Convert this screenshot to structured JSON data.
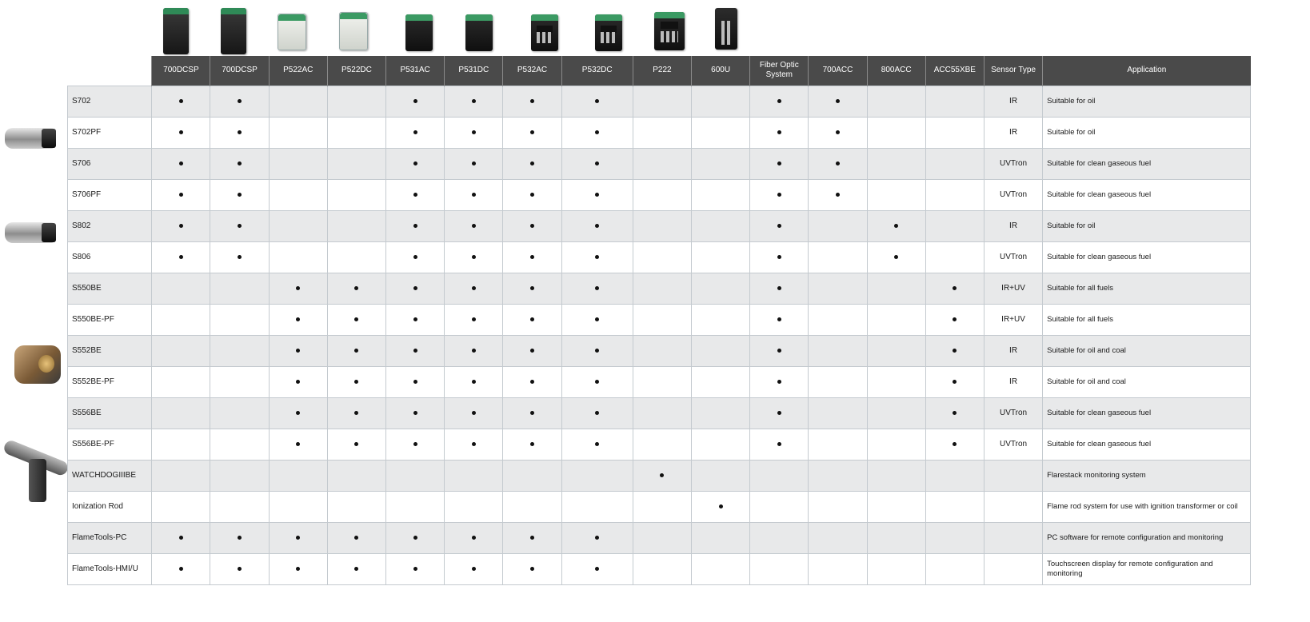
{
  "columns": [
    "700DCSP",
    "700DCSP",
    "P522AC",
    "P522DC",
    "P531AC",
    "P531DC",
    "P532AC",
    "P532DC",
    "P222",
    "600U",
    "Fiber Optic System",
    "700ACC",
    "800ACC",
    "ACC55XBE",
    "Sensor Type",
    "Application"
  ],
  "rows": [
    {
      "name": "S702",
      "marks": [
        1,
        1,
        0,
        0,
        1,
        1,
        1,
        1,
        0,
        0,
        1,
        1,
        0,
        0
      ],
      "type": "IR",
      "app": "Suitable for oil"
    },
    {
      "name": "S702PF",
      "marks": [
        1,
        1,
        0,
        0,
        1,
        1,
        1,
        1,
        0,
        0,
        1,
        1,
        0,
        0
      ],
      "type": "IR",
      "app": "Suitable for oil"
    },
    {
      "name": "S706",
      "marks": [
        1,
        1,
        0,
        0,
        1,
        1,
        1,
        1,
        0,
        0,
        1,
        1,
        0,
        0
      ],
      "type": "UVTron",
      "app": "Suitable for clean gaseous fuel"
    },
    {
      "name": "S706PF",
      "marks": [
        1,
        1,
        0,
        0,
        1,
        1,
        1,
        1,
        0,
        0,
        1,
        1,
        0,
        0
      ],
      "type": "UVTron",
      "app": "Suitable for clean gaseous fuel"
    },
    {
      "name": "S802",
      "marks": [
        1,
        1,
        0,
        0,
        1,
        1,
        1,
        1,
        0,
        0,
        1,
        0,
        1,
        0
      ],
      "type": "IR",
      "app": "Suitable for oil"
    },
    {
      "name": "S806",
      "marks": [
        1,
        1,
        0,
        0,
        1,
        1,
        1,
        1,
        0,
        0,
        1,
        0,
        1,
        0
      ],
      "type": "UVTron",
      "app": "Suitable for clean gaseous fuel"
    },
    {
      "name": "S550BE",
      "marks": [
        0,
        0,
        1,
        1,
        1,
        1,
        1,
        1,
        0,
        0,
        1,
        0,
        0,
        1
      ],
      "type": "IR+UV",
      "app": "Suitable for all fuels"
    },
    {
      "name": "S550BE-PF",
      "marks": [
        0,
        0,
        1,
        1,
        1,
        1,
        1,
        1,
        0,
        0,
        1,
        0,
        0,
        1
      ],
      "type": "IR+UV",
      "app": "Suitable for all fuels"
    },
    {
      "name": "S552BE",
      "marks": [
        0,
        0,
        1,
        1,
        1,
        1,
        1,
        1,
        0,
        0,
        1,
        0,
        0,
        1
      ],
      "type": "IR",
      "app": "Suitable for oil and coal"
    },
    {
      "name": "S552BE-PF",
      "marks": [
        0,
        0,
        1,
        1,
        1,
        1,
        1,
        1,
        0,
        0,
        1,
        0,
        0,
        1
      ],
      "type": "IR",
      "app": "Suitable for oil and coal"
    },
    {
      "name": "S556BE",
      "marks": [
        0,
        0,
        1,
        1,
        1,
        1,
        1,
        1,
        0,
        0,
        1,
        0,
        0,
        1
      ],
      "type": "UVTron",
      "app": "Suitable for clean gaseous fuel"
    },
    {
      "name": "S556BE-PF",
      "marks": [
        0,
        0,
        1,
        1,
        1,
        1,
        1,
        1,
        0,
        0,
        1,
        0,
        0,
        1
      ],
      "type": "UVTron",
      "app": "Suitable for clean gaseous fuel"
    },
    {
      "name": "WATCHDOGIIIBE",
      "marks": [
        0,
        0,
        0,
        0,
        0,
        0,
        0,
        0,
        1,
        0,
        0,
        0,
        0,
        0
      ],
      "type": "",
      "app": "Flarestack monitoring system"
    },
    {
      "name": "Ionization Rod",
      "marks": [
        0,
        0,
        0,
        0,
        0,
        0,
        0,
        0,
        0,
        1,
        0,
        0,
        0,
        0
      ],
      "type": "",
      "app": "Flame rod system for use with ignition transformer or coil"
    },
    {
      "name": "FlameTools-PC",
      "marks": [
        1,
        1,
        1,
        1,
        1,
        1,
        1,
        1,
        0,
        0,
        0,
        0,
        0,
        0
      ],
      "type": "",
      "app": "PC software for remote configuration and monitoring"
    },
    {
      "name": "FlameTools-HMI/U",
      "marks": [
        1,
        1,
        1,
        1,
        1,
        1,
        1,
        1,
        0,
        0,
        0,
        0,
        0,
        0
      ],
      "type": "",
      "app": "Touchscreen display for remote configuration and monitoring"
    }
  ],
  "devices": [
    {
      "name": "700dcsp-unit-1",
      "style": "dark"
    },
    {
      "name": "700dcsp-unit-2",
      "style": "dark"
    },
    {
      "name": "p522ac-unit",
      "style": "light"
    },
    {
      "name": "p522dc-unit",
      "style": "light"
    },
    {
      "name": "p531ac-unit",
      "style": "mid"
    },
    {
      "name": "p531dc-unit",
      "style": "mid"
    },
    {
      "name": "p532ac-unit",
      "style": "keypad"
    },
    {
      "name": "p532dc-unit",
      "style": "keypad"
    },
    {
      "name": "p222-unit",
      "style": "keypad"
    },
    {
      "name": "600u-unit",
      "style": "mid"
    }
  ],
  "colors": {
    "header_bg": "#4a4a4a",
    "row_shade": "#e8e9ea",
    "grid_line": "#c4cacf",
    "dot": "#111111"
  }
}
